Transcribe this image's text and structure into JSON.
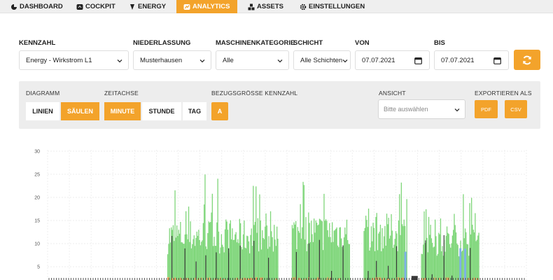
{
  "nav": {
    "items": [
      {
        "label": "DASHBOARD",
        "icon": "dashboard-icon"
      },
      {
        "label": "COCKPIT",
        "icon": "cockpit-icon"
      },
      {
        "label": "ENERGY",
        "icon": "energy-icon"
      },
      {
        "label": "ANALYTICS",
        "icon": "analytics-icon",
        "active": true
      },
      {
        "label": "ASSETS",
        "icon": "assets-icon"
      },
      {
        "label": "EINSTELLUNGEN",
        "icon": "gear-icon"
      }
    ]
  },
  "filters": {
    "kennzahl": {
      "label": "KENNZAHL",
      "value": "Energy - Wirkstrom L1"
    },
    "niederlassung": {
      "label": "NIEDERLASSUNG",
      "value": "Musterhausen"
    },
    "maschinenkategorie": {
      "label": "MASCHINENKATEGORIE",
      "value": "Alle"
    },
    "schicht": {
      "label": "SCHICHT",
      "value": "Alle Schichten"
    },
    "von": {
      "label": "VON",
      "value": "07.07.2021"
    },
    "bis": {
      "label": "BIS",
      "value": "07.07.2021"
    }
  },
  "panel": {
    "diagramm": {
      "label": "DIAGRAMM",
      "options": [
        "LINIEN",
        "SÄULEN"
      ],
      "selected": "SÄULEN"
    },
    "zeitachse": {
      "label": "ZEITACHSE",
      "options": [
        "MINUTE",
        "STUNDE",
        "TAG"
      ],
      "selected": "MINUTE"
    },
    "bezugsgroesse": {
      "label": "BEZUGSGRÖSSE KENNZAHL",
      "button": "A"
    },
    "ansicht": {
      "label": "ANSICHT",
      "placeholder": "Bitte auswählen"
    },
    "export": {
      "label": "EXPORTIEREN ALS",
      "pdf": "PDF",
      "csv": "CSV"
    }
  },
  "colors": {
    "accent": "#f3a32b",
    "series_green": "#7fd67a",
    "series_orange": "#f2a45c",
    "series_dark": "#3a3a3a",
    "series_blue": "#7fb2e6"
  },
  "chart_data": {
    "type": "bar",
    "title": "",
    "xlabel": "",
    "ylabel": "",
    "ylim": [
      0,
      30
    ],
    "yticks": [
      "30",
      "25",
      "20",
      "15",
      "10",
      "5"
    ],
    "grid": true,
    "active_periods": [
      {
        "x_start": 0.25,
        "x_end": 0.48,
        "green_typical": 14,
        "green_peak": 25,
        "orange_typical": 2
      },
      {
        "x_start": 0.51,
        "x_end": 0.63,
        "green_typical": 15,
        "green_peak": 25,
        "orange_typical": 2
      },
      {
        "x_start": 0.66,
        "x_end": 0.75,
        "green_typical": 15,
        "green_peak": 24,
        "orange_typical": 2
      },
      {
        "x_start": 0.78,
        "x_end": 0.9,
        "green_typical": 13,
        "green_peak": 23,
        "orange_typical": 2
      }
    ]
  }
}
